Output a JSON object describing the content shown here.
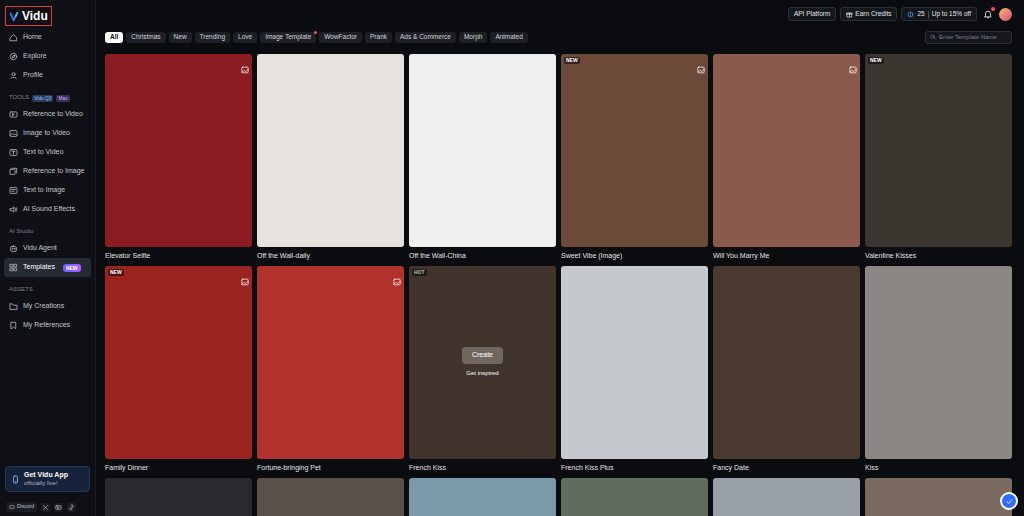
{
  "logo": {
    "text": "Vidu"
  },
  "header": {
    "links": [
      {
        "label": "API Platform"
      },
      {
        "label": "Earn Credits"
      }
    ],
    "credits": {
      "count": "25",
      "offer": "Up to 15% off"
    },
    "notifications": {
      "unread": true
    }
  },
  "sidebar": {
    "top_items": [
      {
        "label": "Home",
        "selected": false
      },
      {
        "label": "Explore",
        "selected": false
      },
      {
        "label": "Profile",
        "selected": false
      }
    ],
    "sections": [
      {
        "label": "TOOLS",
        "badges": [
          "Vidu Q3",
          "Max"
        ],
        "items": [
          {
            "label": "Reference to Video",
            "selected": false
          },
          {
            "label": "Image to Video",
            "selected": false
          },
          {
            "label": "Text to Video",
            "selected": false
          },
          {
            "label": "Reference to Image",
            "selected": false
          },
          {
            "label": "Text to Image",
            "selected": false
          },
          {
            "label": "AI Sound Effects",
            "selected": false
          }
        ]
      },
      {
        "label": "AI Studio",
        "badges": [],
        "items": [
          {
            "label": "Vidu Agent",
            "selected": false
          },
          {
            "label": "Templates",
            "selected": true,
            "badge": "NEW"
          }
        ]
      },
      {
        "label": "ASSETS",
        "badges": [],
        "items": [
          {
            "label": "My Creations",
            "selected": false
          },
          {
            "label": "My References",
            "selected": false
          }
        ]
      }
    ]
  },
  "app_promo": {
    "title": "Get Vidu App",
    "subtitle": "officially live!"
  },
  "social_links": [
    {
      "label": "Discord"
    }
  ],
  "filters": [
    {
      "label": "All",
      "selected": true
    },
    {
      "label": "Christmas",
      "selected": false
    },
    {
      "label": "New",
      "selected": false
    },
    {
      "label": "Trending",
      "selected": false
    },
    {
      "label": "Love",
      "selected": false
    },
    {
      "label": "Image Template",
      "selected": false,
      "dot": true
    },
    {
      "label": "WowFactor",
      "selected": false
    },
    {
      "label": "Prank",
      "selected": false
    },
    {
      "label": "Ads & Commerce",
      "selected": false
    },
    {
      "label": "Morph",
      "selected": false
    },
    {
      "label": "Animated",
      "selected": false
    }
  ],
  "search": {
    "placeholder": "Enter Template Name"
  },
  "templates": [
    {
      "name": "Elevator Selfie",
      "kind": "image",
      "color": "#8a1c22"
    },
    {
      "name": "Off the Wall-daily",
      "kind": "video",
      "color": "#e6e3df"
    },
    {
      "name": "Off the Wall-China",
      "kind": "video",
      "color": "#efefef"
    },
    {
      "name": "Sweet Vibe  (Image)",
      "kind": "image",
      "color": "#6b4a3a",
      "badge": "NEW"
    },
    {
      "name": "Will You Marry Me",
      "kind": "image",
      "color": "#8c5a4c"
    },
    {
      "name": "Valentine Kisses",
      "kind": "video",
      "color": "#3c3631",
      "badge": "NEW"
    },
    {
      "name": "Family Dinner",
      "kind": "image",
      "color": "#9a2420",
      "badge": "NEW"
    },
    {
      "name": "Fortune-bringing Pet",
      "kind": "image",
      "color": "#b0322a"
    },
    {
      "name": "French Kiss",
      "kind": "video",
      "color": "#5c4b40",
      "badge": "HOT",
      "hovered": true,
      "actions": {
        "primary": "Create",
        "secondary": "Get inspired"
      }
    },
    {
      "name": "French Kiss Plus",
      "kind": "video",
      "color": "#c5c9ce"
    },
    {
      "name": "Fancy Date",
      "kind": "video",
      "color": "#4a3a30"
    },
    {
      "name": "Kiss",
      "kind": "video",
      "color": "#8a8784"
    }
  ],
  "more_templates": [
    {
      "color": "#2a2a2e"
    },
    {
      "color": "#5a5048"
    },
    {
      "color": "#7a9aa8"
    },
    {
      "color": "#5f6e5c"
    },
    {
      "color": "#9aa0a8"
    },
    {
      "color": "#7a6a60"
    }
  ]
}
